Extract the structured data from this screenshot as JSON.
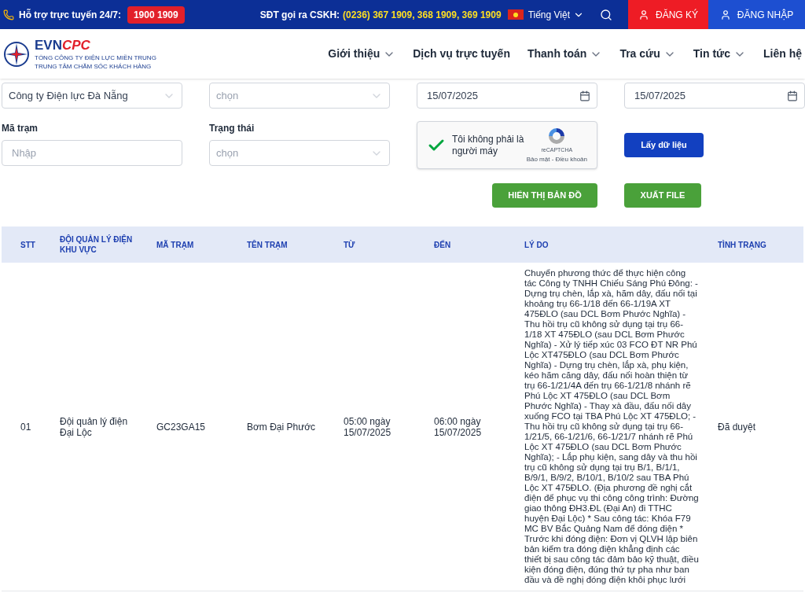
{
  "top_bar": {
    "support_label": "Hỗ trợ trực tuyến 24/7:",
    "hotline": "1900 1909",
    "cskh_label": "SĐT gọi ra CSKH:",
    "cskh_numbers": "(0236) 367 1909, 368 1909, 369 1909",
    "language": "Tiếng Việt",
    "register": "ĐĂNG KÝ",
    "login": "ĐĂNG NHẬP"
  },
  "header": {
    "logo_text_1": "EVN",
    "logo_text_2": "CPC",
    "org_line_1": "TỔNG CÔNG TY ĐIỆN LỰC MIỀN TRUNG",
    "org_line_2": "TRUNG TÂM CHĂM SÓC KHÁCH HÀNG",
    "nav": [
      {
        "label": "Giới thiệu",
        "dropdown": true
      },
      {
        "label": "Dịch vụ trực tuyến",
        "dropdown": false
      },
      {
        "label": "Thanh toán",
        "dropdown": true
      },
      {
        "label": "Tra cứu",
        "dropdown": true
      },
      {
        "label": "Tin tức",
        "dropdown": true
      },
      {
        "label": "Liên hệ",
        "dropdown": false
      }
    ]
  },
  "form": {
    "company_select": "Công ty Điện lực Đà Nẵng",
    "unit_select_placeholder": "chọn",
    "date_from": "15/07/2025",
    "date_to": "15/07/2025",
    "station_label": "Mã trạm",
    "station_placeholder": "Nhập",
    "status_label": "Trạng thái",
    "status_placeholder": "chọn",
    "captcha": {
      "checked": true,
      "text": "Tôi không phải là người máy",
      "brand": "reCAPTCHA",
      "links": "Bảo mật - Điều khoản"
    },
    "fetch_button": "Lấy dữ liệu",
    "map_button": "HIỂN THỊ BẢN ĐỒ",
    "export_button": "XUẤT FILE"
  },
  "table": {
    "columns": [
      "STT",
      "ĐỘI QUẢN LÝ ĐIỆN KHU VỰC",
      "MÃ TRẠM",
      "TÊN TRẠM",
      "TỪ",
      "ĐẾN",
      "LÝ DO",
      "TÌNH TRẠNG"
    ],
    "rows": [
      [
        "01",
        "Đội quản lý điện Đại Lộc",
        "GC23GA15",
        "Bơm Đại Phước",
        "05:00 ngày 15/07/2025",
        "06:00 ngày 15/07/2025",
        "Chuyển phương thức để thực hiện công tác Công ty TNHH Chiếu Sáng Phú Đông: - Dựng trụ chèn, lắp xà, hãm dây, đấu nối tại khoảng trụ 66-1/18 đến 66-1/19A XT 475ĐLO (sau DCL Bơm Phước Nghĩa) - Thu hồi trụ cũ không sử dụng tại trụ 66-1/18 XT 475ĐLO (sau DCL Bơm Phước Nghĩa) - Xử lý tiếp xúc 03 FCO ĐT NR Phú Lộc XT475ĐLO (sau DCL Bơm Phước Nghĩa) - Dựng trụ chèn, lắp xà, phụ kiện, kéo hãm căng dây, đấu nối hoàn thiện từ trụ 66-1/21/4A đến trụ 66-1/21/8 nhánh rẽ Phú Lộc XT 475ĐLO (sau DCL Bơm Phước Nghĩa) - Thay xà đầu, đấu nối dây xuống FCO tại TBA Phú Lộc XT 475ĐLO; - Thu hồi trụ cũ không sử dụng tại trụ 66-1/21/5, 66-1/21/6, 66-1/21/7 nhánh rẽ Phú Lộc XT 475ĐLO (sau DCL Bơm Phước Nghĩa); - Lắp phụ kiện, sang dây và thu hồi trụ cũ không sử dụng tại trụ B/1, B/1/1, B/9/1, B/9/2, B/10/1, B/10/2 sau TBA Phú Lộc XT 475ĐLO. (Địa phương đề nghị cắt điện để phục vụ thi công công trình: Đường giao thông ĐH3.ĐL (Đại An) đi TTHC huyện Đại Lộc) * Sau công tác: Khóa F79 MC BV Bắc Quảng Nam để đóng điện * Trước khi đóng điện: Đơn vị QLVH lập biên bản kiểm tra đóng điện khẳng định các thiết bị sau công tác đảm bảo kỹ thuật, điều kiện đóng điện, đúng thứ tự pha như ban đầu và đề nghị đóng điện khôi phục lưới",
        "Đã duyệt"
      ]
    ]
  }
}
